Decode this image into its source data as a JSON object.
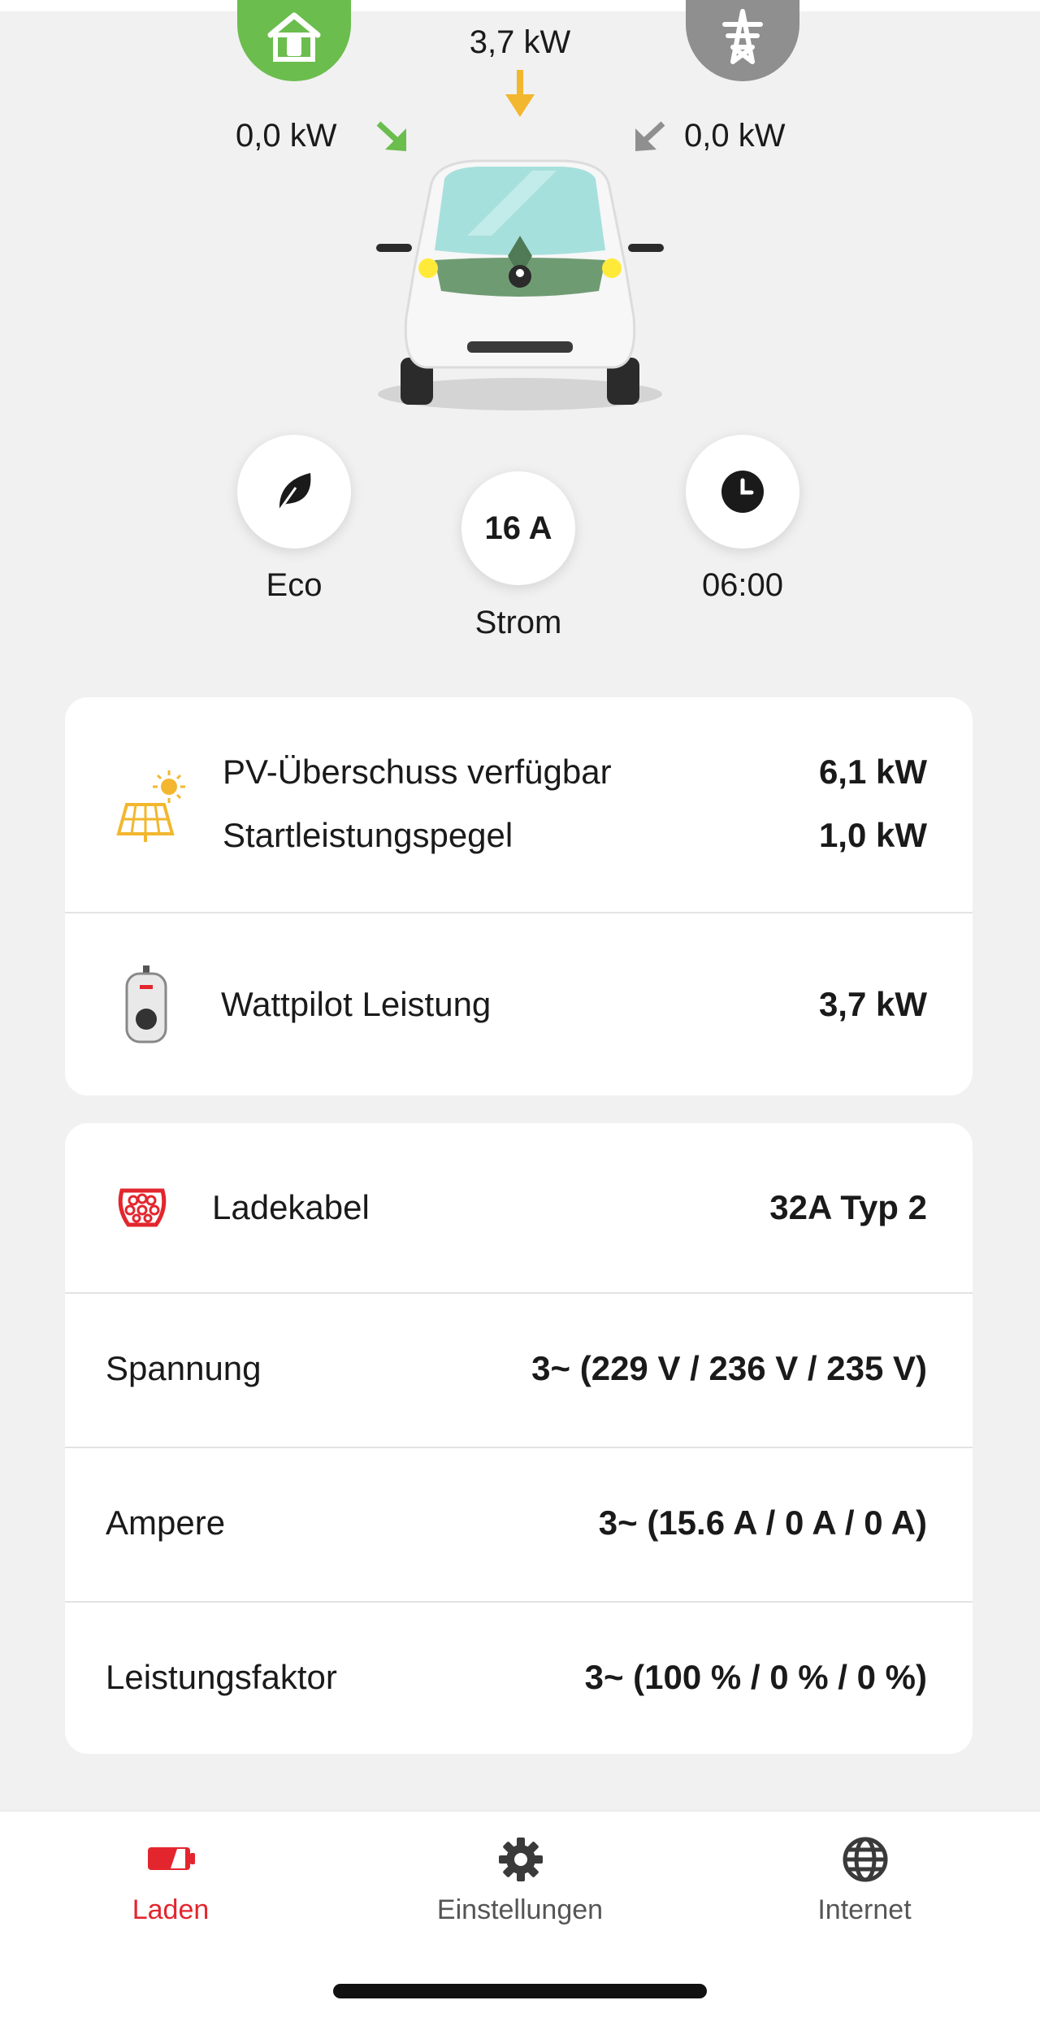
{
  "colors": {
    "accent_red": "#e3262e",
    "green": "#6bbd4e",
    "grid_grey": "#8f8f8f",
    "yellow": "#f2b72e"
  },
  "flow": {
    "pv": {
      "value": "3,7 kW",
      "icon": "arrow-down-icon"
    },
    "home": {
      "value": "0,0 kW",
      "icon": "home-charger-icon"
    },
    "grid": {
      "value": "0,0 kW",
      "icon": "power-grid-pylon-icon"
    }
  },
  "controls": {
    "mode": {
      "label": "Eco",
      "icon": "leaf-icon"
    },
    "current": {
      "value": "16 A",
      "label": "Strom"
    },
    "timer": {
      "label": "06:00",
      "icon": "clock-icon"
    }
  },
  "pv_card": {
    "surplus_label": "PV-Überschuss verfügbar",
    "surplus_value": "6,1 kW",
    "start_label": "Startleistungspegel",
    "start_value": "1,0 kW",
    "wattpilot_label": "Wattpilot Leistung",
    "wattpilot_value": "3,7 kW"
  },
  "details": {
    "cable_label": "Ladekabel",
    "cable_value": "32A Typ 2",
    "voltage_label": "Spannung",
    "voltage_value": "3~ (229 V / 236 V / 235 V)",
    "ampere_label": "Ampere",
    "ampere_value": "3~ (15.6 A / 0 A / 0 A)",
    "pf_label": "Leistungsfaktor",
    "pf_value": "3~ (100 % / 0 % / 0 %)"
  },
  "nav": {
    "items": [
      {
        "label": "Laden",
        "icon": "battery-charging-icon",
        "active": true
      },
      {
        "label": "Einstellungen",
        "icon": "gear-icon",
        "active": false
      },
      {
        "label": "Internet",
        "icon": "globe-icon",
        "active": false
      }
    ]
  }
}
